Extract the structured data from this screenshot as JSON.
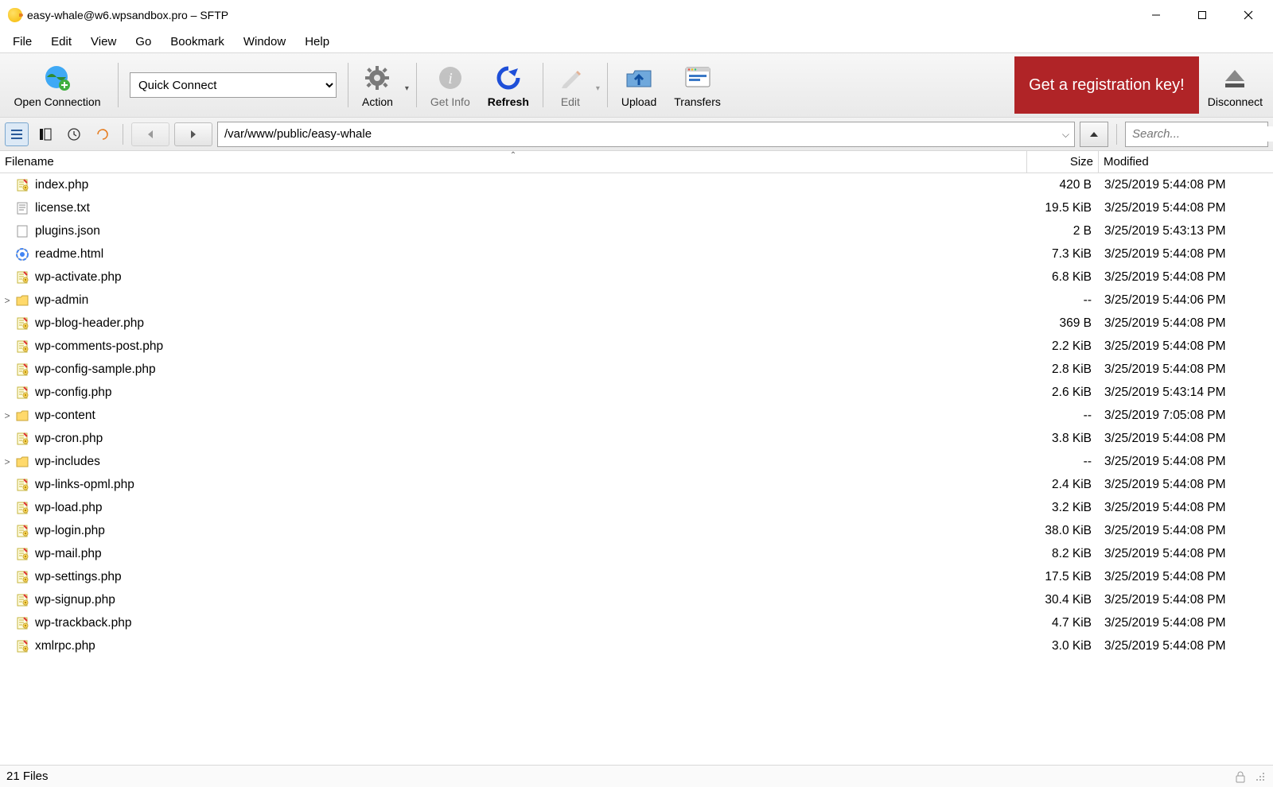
{
  "window": {
    "title": "easy-whale@w6.wpsandbox.pro – SFTP"
  },
  "menu": [
    "File",
    "Edit",
    "View",
    "Go",
    "Bookmark",
    "Window",
    "Help"
  ],
  "toolbar": {
    "open_connection": "Open Connection",
    "quick_connect_selected": "Quick Connect",
    "action": "Action",
    "get_info": "Get Info",
    "refresh": "Refresh",
    "edit": "Edit",
    "upload": "Upload",
    "transfers": "Transfers",
    "registration_banner": "Get a registration key!",
    "disconnect": "Disconnect"
  },
  "nav": {
    "path": "/var/www/public/easy-whale",
    "search_placeholder": "Search..."
  },
  "columns": {
    "filename": "Filename",
    "size": "Size",
    "modified": "Modified"
  },
  "files": [
    {
      "name": "index.php",
      "type": "php",
      "size": "420 B",
      "modified": "3/25/2019 5:44:08 PM"
    },
    {
      "name": "license.txt",
      "type": "txt",
      "size": "19.5 KiB",
      "modified": "3/25/2019 5:44:08 PM"
    },
    {
      "name": "plugins.json",
      "type": "file",
      "size": "2 B",
      "modified": "3/25/2019 5:43:13 PM"
    },
    {
      "name": "readme.html",
      "type": "html",
      "size": "7.3 KiB",
      "modified": "3/25/2019 5:44:08 PM"
    },
    {
      "name": "wp-activate.php",
      "type": "php",
      "size": "6.8 KiB",
      "modified": "3/25/2019 5:44:08 PM"
    },
    {
      "name": "wp-admin",
      "type": "folder",
      "size": "--",
      "modified": "3/25/2019 5:44:06 PM"
    },
    {
      "name": "wp-blog-header.php",
      "type": "php",
      "size": "369 B",
      "modified": "3/25/2019 5:44:08 PM"
    },
    {
      "name": "wp-comments-post.php",
      "type": "php",
      "size": "2.2 KiB",
      "modified": "3/25/2019 5:44:08 PM"
    },
    {
      "name": "wp-config-sample.php",
      "type": "php",
      "size": "2.8 KiB",
      "modified": "3/25/2019 5:44:08 PM"
    },
    {
      "name": "wp-config.php",
      "type": "php",
      "size": "2.6 KiB",
      "modified": "3/25/2019 5:43:14 PM"
    },
    {
      "name": "wp-content",
      "type": "folder",
      "size": "--",
      "modified": "3/25/2019 7:05:08 PM"
    },
    {
      "name": "wp-cron.php",
      "type": "php",
      "size": "3.8 KiB",
      "modified": "3/25/2019 5:44:08 PM"
    },
    {
      "name": "wp-includes",
      "type": "folder",
      "size": "--",
      "modified": "3/25/2019 5:44:08 PM"
    },
    {
      "name": "wp-links-opml.php",
      "type": "php",
      "size": "2.4 KiB",
      "modified": "3/25/2019 5:44:08 PM"
    },
    {
      "name": "wp-load.php",
      "type": "php",
      "size": "3.2 KiB",
      "modified": "3/25/2019 5:44:08 PM"
    },
    {
      "name": "wp-login.php",
      "type": "php",
      "size": "38.0 KiB",
      "modified": "3/25/2019 5:44:08 PM"
    },
    {
      "name": "wp-mail.php",
      "type": "php",
      "size": "8.2 KiB",
      "modified": "3/25/2019 5:44:08 PM"
    },
    {
      "name": "wp-settings.php",
      "type": "php",
      "size": "17.5 KiB",
      "modified": "3/25/2019 5:44:08 PM"
    },
    {
      "name": "wp-signup.php",
      "type": "php",
      "size": "30.4 KiB",
      "modified": "3/25/2019 5:44:08 PM"
    },
    {
      "name": "wp-trackback.php",
      "type": "php",
      "size": "4.7 KiB",
      "modified": "3/25/2019 5:44:08 PM"
    },
    {
      "name": "xmlrpc.php",
      "type": "php",
      "size": "3.0 KiB",
      "modified": "3/25/2019 5:44:08 PM"
    }
  ],
  "status": {
    "count_text": "21 Files"
  }
}
